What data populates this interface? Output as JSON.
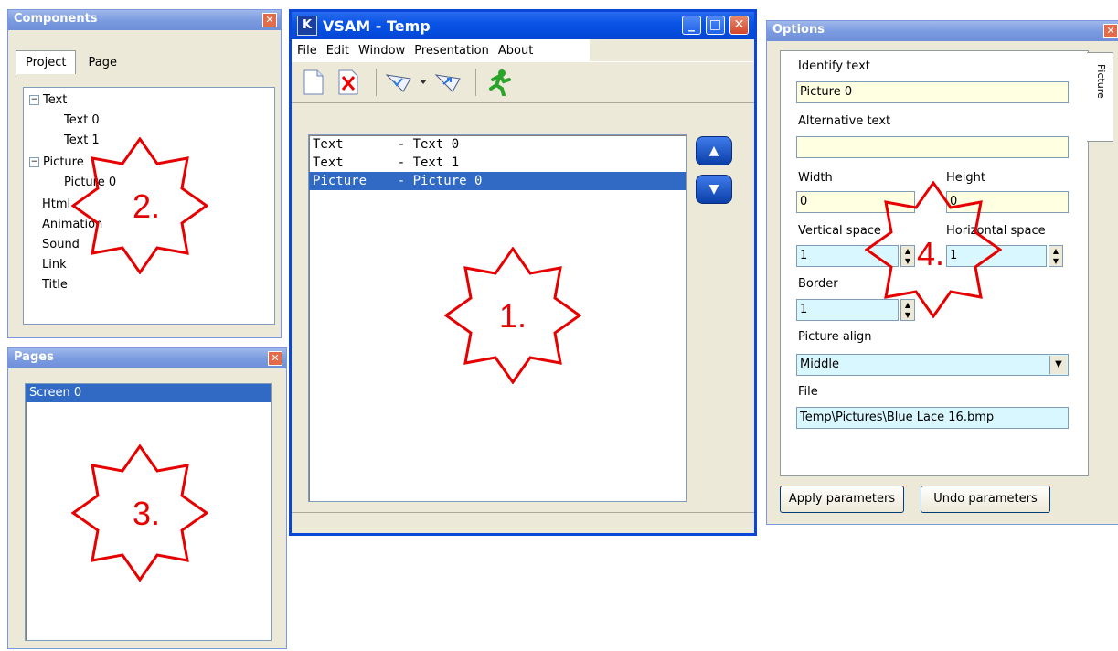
{
  "components": {
    "title": "Components",
    "tabs": [
      "Project",
      "Page"
    ],
    "tree": {
      "text": "Text",
      "text0": "Text 0",
      "text1": "Text 1",
      "picture": "Picture",
      "picture0": "Picture 0",
      "html": "Html",
      "animation": "Animation",
      "sound": "Sound",
      "link": "Link",
      "titleItem": "Title"
    }
  },
  "pages": {
    "title": "Pages",
    "items": [
      "Screen 0"
    ]
  },
  "main": {
    "icon_letter": "K",
    "title": "VSAM - Temp",
    "menu": [
      "File",
      "Edit",
      "Window",
      "Presentation",
      "About"
    ],
    "list": [
      "Text       - Text 0",
      "Text       - Text 1",
      "Picture    - Picture 0"
    ]
  },
  "options": {
    "title": "Options",
    "side_tab": "Picture",
    "identify_label": "Identify text",
    "identify_value": "Picture 0",
    "alt_label": "Alternative text",
    "alt_value": "",
    "width_label": "Width",
    "width_value": "0",
    "height_label": "Height",
    "height_value": "0",
    "vspace_label": "Vertical space",
    "vspace_value": "1",
    "hspace_label": "Horizontal space",
    "hspace_value": "1",
    "border_label": "Border",
    "border_value": "1",
    "align_label": "Picture align",
    "align_value": "Middle",
    "file_label": "File",
    "file_value": "Temp\\Pictures\\Blue Lace 16.bmp",
    "apply": "Apply parameters",
    "undo": "Undo parameters"
  },
  "annotations": [
    "1.",
    "2.",
    "3.",
    "4."
  ],
  "colors": {
    "annotation": "#e60000",
    "selection": "#316ac5",
    "field_yellow": "#ffffe1",
    "field_cyan": "#d9f7ff"
  }
}
